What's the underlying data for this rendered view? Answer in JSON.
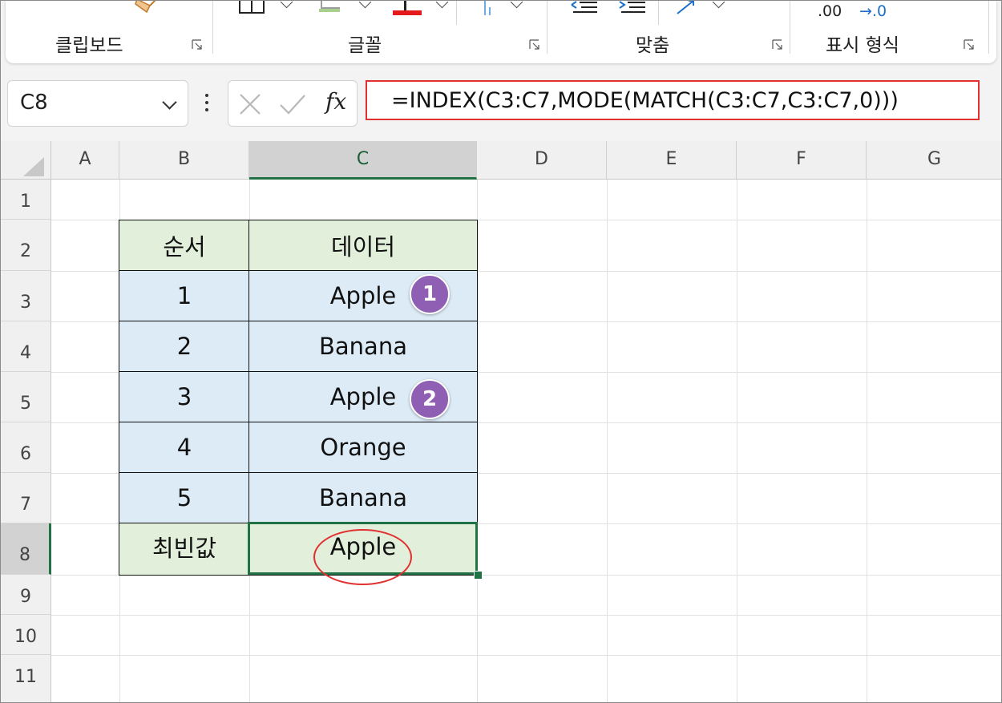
{
  "ribbon": {
    "groups": [
      {
        "label": "클립보드"
      },
      {
        "label": "글꼴"
      },
      {
        "label": "맞춤"
      },
      {
        "label": "표시 형식"
      }
    ],
    "number_format_fragment_1": ".00",
    "number_format_fragment_2": "→.0"
  },
  "formula_bar": {
    "name_box": "C8",
    "fx_label": "fx",
    "formula": "=INDEX(C3:C7,MODE(MATCH(C3:C7,C3:C7,0)))"
  },
  "sheet": {
    "columns": [
      "A",
      "B",
      "C",
      "D",
      "E",
      "F",
      "G"
    ],
    "selected_column": "C",
    "rows": [
      "1",
      "2",
      "3",
      "4",
      "5",
      "6",
      "7",
      "8",
      "9",
      "10",
      "11"
    ],
    "selected_row": "8",
    "table": {
      "header": [
        "순서",
        "데이터"
      ],
      "rows": [
        [
          "1",
          "Apple"
        ],
        [
          "2",
          "Banana"
        ],
        [
          "3",
          "Apple"
        ],
        [
          "4",
          "Orange"
        ],
        [
          "5",
          "Banana"
        ]
      ],
      "result_label": "최빈값",
      "result_value": "Apple"
    },
    "badges": [
      "1",
      "2"
    ]
  },
  "colors": {
    "header_fill": "#e2efda",
    "data_fill": "#ddebf7",
    "selection": "#217346",
    "highlight": "#e03030",
    "badge": "#8e5fb2"
  }
}
